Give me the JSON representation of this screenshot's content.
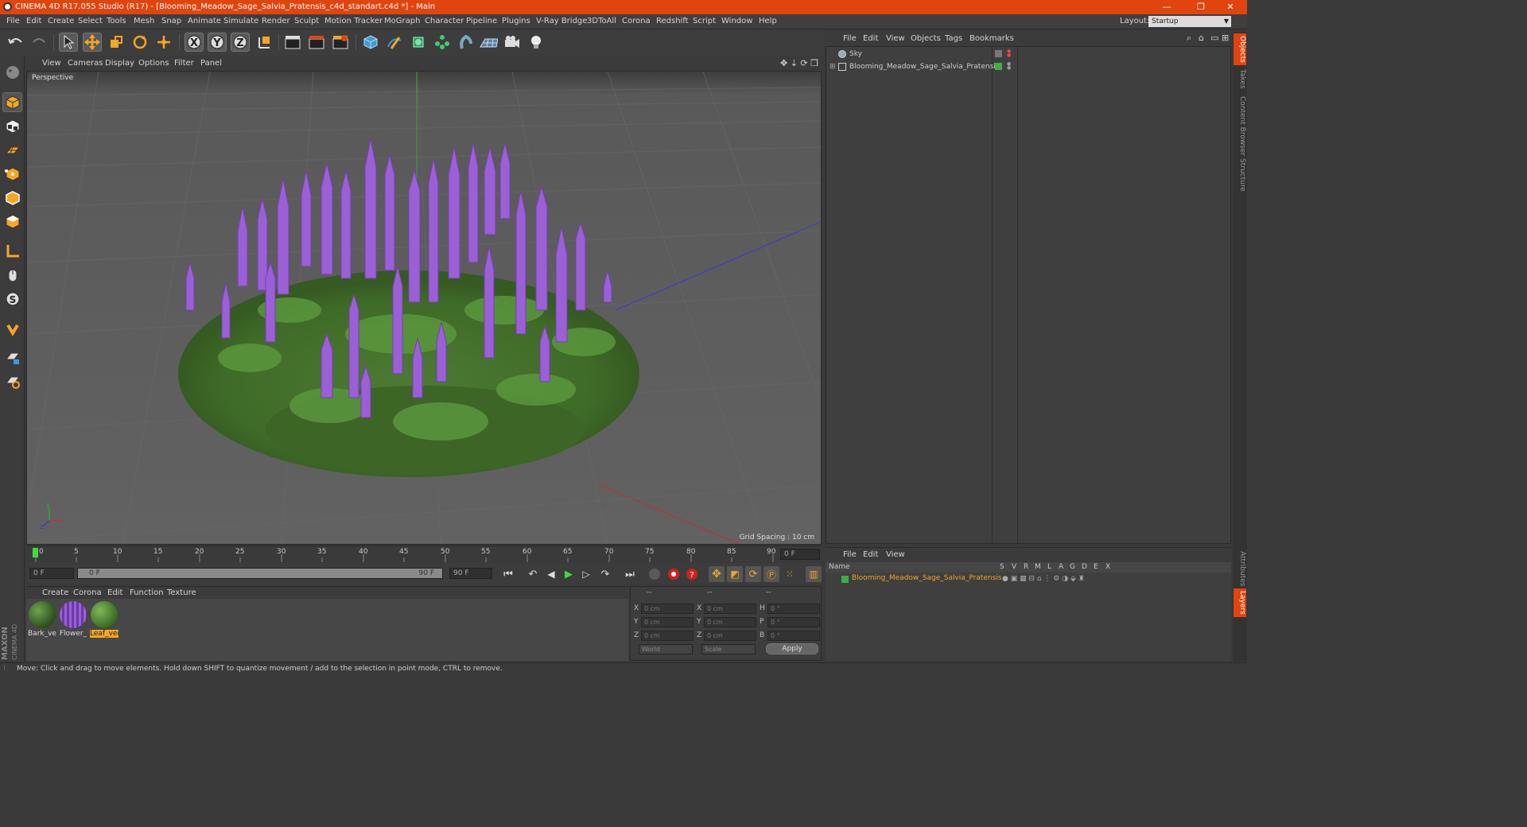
{
  "window": {
    "title": "CINEMA 4D R17.055 Studio (R17) - [Blooming_Meadow_Sage_Salvia_Pratensis_c4d_standart.c4d *] - Main",
    "min": "—",
    "restore": "❐",
    "close": "✕"
  },
  "menubar": {
    "items": [
      "File",
      "Edit",
      "Create",
      "Select",
      "Tools",
      "Mesh",
      "Snap",
      "Animate",
      "Simulate",
      "Render",
      "Sculpt",
      "Motion Tracker",
      "MoGraph",
      "Character",
      "Pipeline",
      "Plugins",
      "V-Ray Bridge",
      "3DToAll",
      "Corona",
      "Redshift",
      "Script",
      "Window",
      "Help"
    ],
    "layout_label": "Layout:",
    "layout_value": "Startup"
  },
  "viewport": {
    "menu": [
      "View",
      "Cameras",
      "Display",
      "Options",
      "Filter",
      "Panel"
    ],
    "label": "Perspective",
    "grid_spacing": "Grid Spacing : 10 cm",
    "axis_x": "x",
    "axis_y": "y",
    "axis_z": "z"
  },
  "timeline": {
    "ticks": [
      "0",
      "5",
      "10",
      "15",
      "20",
      "25",
      "30",
      "35",
      "40",
      "45",
      "50",
      "55",
      "60",
      "65",
      "70",
      "75",
      "80",
      "85",
      "90"
    ],
    "current_frame": "0 F",
    "start": "0 F",
    "range_start": "0 F",
    "range_end": "90 F",
    "end": "90 F"
  },
  "materials": {
    "menu": [
      "Create",
      "Corona",
      "Edit",
      "Function",
      "Texture"
    ],
    "items": [
      {
        "name": "Bark_ver",
        "color": "#3d6b2a"
      },
      {
        "name": "Flower_",
        "color": "#8b4fc4"
      },
      {
        "name": "Leaf_ver",
        "color": "#4a7a30",
        "selected": true
      }
    ],
    "logo_line1": "MAXON",
    "logo_line2": "CINEMA 4D"
  },
  "coordinates": {
    "headers": [
      "--",
      "--",
      "--"
    ],
    "rows": [
      {
        "a": "X",
        "av": "0 cm",
        "b": "X",
        "bv": "0 cm",
        "c": "H",
        "cv": "0 °"
      },
      {
        "a": "Y",
        "av": "0 cm",
        "b": "Y",
        "bv": "0 cm",
        "c": "P",
        "cv": "0 °"
      },
      {
        "a": "Z",
        "av": "0 cm",
        "b": "Z",
        "bv": "0 cm",
        "c": "B",
        "cv": "0 °"
      }
    ],
    "space": "World",
    "mode": "Scale",
    "apply": "Apply"
  },
  "objects": {
    "menu": [
      "File",
      "Edit",
      "View",
      "Objects",
      "Tags",
      "Bookmarks"
    ],
    "items": [
      {
        "name": "Sky"
      },
      {
        "name": "Blooming_Meadow_Sage_Salvia_Pratensis"
      }
    ]
  },
  "layers": {
    "menu": [
      "File",
      "Edit",
      "View"
    ],
    "name_header": "Name",
    "columns": [
      "S",
      "V",
      "R",
      "M",
      "L",
      "A",
      "G",
      "D",
      "E",
      "X"
    ],
    "items": [
      {
        "name": "Blooming_Meadow_Sage_Salvia_Pratensis",
        "color": "#3cb043"
      }
    ]
  },
  "right_tabs": [
    "Objects",
    "Takes",
    "Content Browser",
    "Structure",
    "Attributes",
    "Layers"
  ],
  "status": "Move: Click and drag to move elements. Hold down SHIFT to quantize movement / add to the selection in point mode, CTRL to remove.",
  "colors": {
    "accent": "#e0450f",
    "orange_icon": "#f5a623",
    "plant_flower": "#9b5fd6",
    "plant_leaf": "#4f8a35"
  }
}
